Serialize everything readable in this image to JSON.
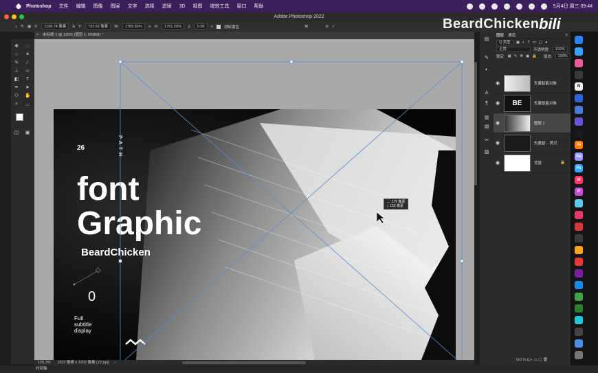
{
  "menubar": {
    "app": "Photoshop",
    "items": [
      "文件",
      "编辑",
      "图像",
      "图层",
      "文字",
      "选择",
      "滤镜",
      "3D",
      "视图",
      "增效工具",
      "窗口",
      "帮助"
    ],
    "datetime": "5月4日 周三  09:44"
  },
  "titlebar": {
    "title": "Adobe Photoshop 2022"
  },
  "options": {
    "x": "1136.74 像素",
    "y": "732.62 像素",
    "w": "1765.55%",
    "h": "1761.20%",
    "angle": "0.00",
    "antialias": "消除锯齿"
  },
  "watermark": {
    "channel": "BeardChicken",
    "bili": "bilibili"
  },
  "document": {
    "tab": "未标题-1 @ 125% (图层 1, RGB/8) *"
  },
  "artwork": {
    "num26": "26",
    "vertical": "PATH",
    "font": "font",
    "graphic": "Graphic",
    "brand": "BeardChicken",
    "zero": "0",
    "sub1": "Full",
    "sub2": "subtitle",
    "sub3": "display"
  },
  "tooltip": {
    "w": "↔: 175 像素",
    "h": "↕: 152 像素"
  },
  "statusbar": {
    "zoom": "125.3%",
    "info": "1922 像素 x 1202 像素 (72 ppi)",
    "arrow": "›"
  },
  "timeline": {
    "label": "时间轴"
  },
  "layers_panel": {
    "tabs": [
      "图层",
      "通道"
    ],
    "filter": "Q 类型",
    "blend": "正常",
    "opacity_label": "不透明度:",
    "opacity": "100%",
    "lock_label": "锁定:",
    "fill_label": "填充:",
    "fill": "100%",
    "layers": [
      {
        "name": "矢量智能对象",
        "selected": false
      },
      {
        "name": "矢量智能对象",
        "selected": false
      },
      {
        "name": "图层 1",
        "selected": true
      },
      {
        "name": "矢量智... 拷贝",
        "selected": false
      },
      {
        "name": "背景",
        "selected": false
      }
    ],
    "bottom_icons": "GO  fx  ◘  ◐  ▭  ▢  🗑"
  },
  "dock": {
    "apps": [
      "",
      "",
      "",
      "",
      "N",
      "",
      "",
      "",
      "",
      "Ai",
      "Ae",
      "Ps",
      "Id",
      "P",
      "",
      "",
      "",
      "",
      "",
      "",
      "",
      "",
      "",
      "",
      "",
      "",
      "",
      ""
    ],
    "colors": [
      "#2f80ed",
      "#3aa0ff",
      "#e85d9a",
      "#3a3a3a",
      "#f2f2f2",
      "#2f62d8",
      "#4a7bd6",
      "#6b54d8",
      "#1a1a1a",
      "#ff7c00",
      "#9999ff",
      "#31a8ff",
      "#ff3366",
      "#c94dd6",
      "#5fc9e8",
      "#e23a6b",
      "#d23b3b",
      "#3a3a3a",
      "#f5a623",
      "#e53935",
      "#7b1fa2",
      "#1e88e5",
      "#43a047",
      "#2e7d32",
      "#26c6da",
      "#444444",
      "#4a90e2",
      "#777777"
    ]
  }
}
